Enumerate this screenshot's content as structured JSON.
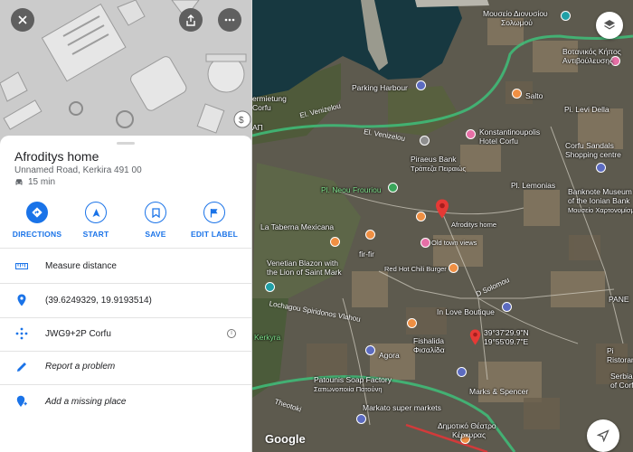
{
  "place": {
    "name": "Afroditys home",
    "address": "Unnamed Road, Kerkira 491 00",
    "eta": "15 min"
  },
  "actions": [
    {
      "label": "DIRECTIONS",
      "icon": "directions-icon"
    },
    {
      "label": "START",
      "icon": "navigation-arrow-icon"
    },
    {
      "label": "SAVE",
      "icon": "bookmark-icon"
    },
    {
      "label": "EDIT LABEL",
      "icon": "flag-icon"
    }
  ],
  "list": [
    {
      "text": "Measure distance",
      "icon": "ruler-icon"
    },
    {
      "text": "(39.6249329, 19.9193514)",
      "icon": "location-pin-icon"
    },
    {
      "text": "JWG9+2P Corfu",
      "icon": "plus-code-icon"
    },
    {
      "text": "Report a problem",
      "icon": "edit-pencil-icon"
    },
    {
      "text": "Add a missing place",
      "icon": "add-place-icon"
    }
  ],
  "map": {
    "attribution": "Google",
    "labels": {
      "mouseio1": "Μουσείο Διονυσίου",
      "mouseio2": "Σολωμού",
      "botanical1": "Βοτανικός Κήπος",
      "botanical2": "Αντιβούλευσης",
      "parking": "Parking Harbour",
      "salto": "Salto",
      "pilevi": "Pi. Levi Della",
      "konst1": "Konstantinoupolis",
      "konst2": "Hotel Corfu",
      "sandals1": "Corfu Sandals",
      "sandals2": "Shopping centre",
      "vermietung1": "ermietung",
      "vermietung2": "Corfu",
      "ap": "ΑΠ",
      "venizelou1": "El. Venizelou",
      "venizelou2": "El. Venizelou",
      "piraeus1": "Piraeus Bank",
      "piraeus2": "Τράπεζα Πειραιώς",
      "neou": "Pl. Neou Frouriou",
      "lemonias": "Pl. Lemonias",
      "banknote1": "Banknote Museum",
      "banknote2": "of the Ionian Bank",
      "banknote3": "Μουσείο Χαρτονομίσματος",
      "taverna": "La Taberna Mexicana",
      "home": "Afroditys home",
      "oldtown": "Old town views",
      "firstfir": "fir-fir",
      "redhot": "Red Hot Chili Burger",
      "venetian1": "Venetian Blazon with",
      "venetian2": "the Lion of Saint Mark",
      "dsolomou": "D Solomou",
      "lochagou": "Lochagou Spiridonos Vlahou",
      "inlove": "In Love Boutique",
      "fishalida1": "Fishalida",
      "fishalida2": "Φισαλίδα",
      "coords1": "39°37'29.9\"N",
      "coords2": "19°55'09.7\"E",
      "kerkyra": "Kerkyra",
      "agora": "Agora",
      "patounis1": "Patounis Soap Factory",
      "patounis2": "Σαπωνοποιία Πατούνη",
      "marks": "Marks & Spencer",
      "panet": "PANE",
      "rest1": "Pi",
      "rest2": "Ristorante Il",
      "serbian1": "Serbian M",
      "serbian2": "of Corfu",
      "markato": "Markato super markets",
      "theatre1": "Δημοτικό Θέατρο",
      "theatre2": "Κέρκυρας",
      "theotoki": "Theotoki"
    }
  }
}
